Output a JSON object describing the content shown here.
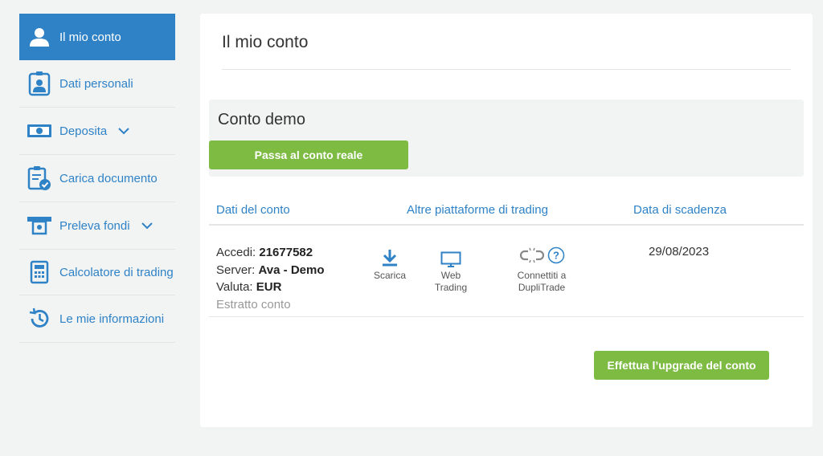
{
  "sidebar": {
    "items": [
      {
        "label": "Il mio conto",
        "icon": "user-icon",
        "active": true
      },
      {
        "label": "Dati personali",
        "icon": "id-badge-icon"
      },
      {
        "label": "Deposita",
        "icon": "banknote-icon",
        "has_dropdown": true
      },
      {
        "label": "Carica documento",
        "icon": "clipboard-check-icon"
      },
      {
        "label": "Preleva fondi",
        "icon": "atm-withdraw-icon",
        "has_dropdown": true
      },
      {
        "label": "Calcolatore di trading",
        "icon": "calculator-icon"
      },
      {
        "label": "Le mie informazioni",
        "icon": "history-icon"
      }
    ]
  },
  "main": {
    "title": "Il mio conto",
    "demo": {
      "title": "Conto demo",
      "switch_button": "Passa al conto reale"
    },
    "columns": {
      "account": "Dati del conto",
      "platforms": "Altre piattaforme di trading",
      "expiry": "Data di scadenza"
    },
    "account": {
      "login_label": "Accedi:",
      "login_value": "21677582",
      "server_label": "Server:",
      "server_value": "Ava - Demo",
      "currency_label": "Valuta:",
      "currency_value": "EUR",
      "statement_link": "Estratto conto"
    },
    "platforms": [
      {
        "label": "Scarica",
        "icon": "download-icon"
      },
      {
        "label": "Web Trading",
        "icon": "monitor-icon"
      },
      {
        "label": "Connettiti a DupliTrade",
        "icon": "broken-link-icon",
        "help_icon": "question-circle-icon"
      }
    ],
    "expiry_date": "29/08/2023",
    "upgrade_button": "Effettua l’upgrade del conto"
  },
  "colors": {
    "accent_blue": "#2f82c6",
    "green_button": "#7dbb42",
    "background": "#f2f4f4"
  }
}
